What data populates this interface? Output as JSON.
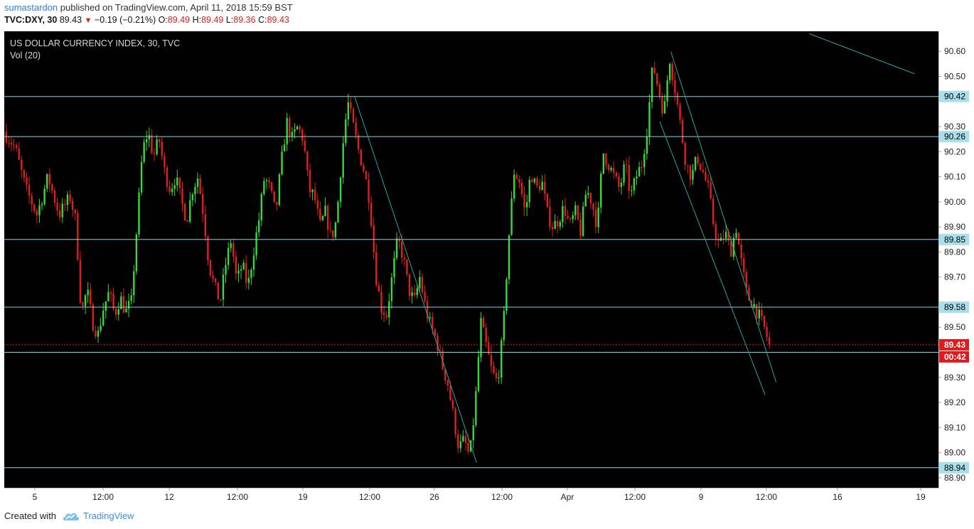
{
  "header": {
    "author": "sumastardon",
    "published_text": "published on TradingView.com, April 11, 2018 15:59 BST",
    "symbol": "TVC:DXY, 30",
    "last": "89.43",
    "change_arrow": "▼",
    "change": "−0.19 (−0.21%)",
    "o_label": "O:",
    "o_value": "89.49",
    "h_label": "H:",
    "h_value": "89.49",
    "l_label": "L:",
    "l_value": "89.36",
    "c_label": "C:",
    "c_value": "89.43"
  },
  "footer": {
    "created_with": "Created with",
    "brand": "TradingView"
  },
  "colors": {
    "background": "#000000",
    "up": "#37d93b",
    "down": "#e0201a",
    "level_line": "#7fd6e6",
    "trend_line": "#26a89a",
    "last_price": "#e01b1b",
    "axis_text": "#222222"
  },
  "chart_data": {
    "type": "candlestick",
    "title": "US DOLLAR CURRENCY INDEX, 30, TVC",
    "indicator": "Vol (20)",
    "ylim": [
      88.86,
      90.68
    ],
    "y_ticks": [
      "90.60",
      "90.50",
      "90.30",
      "90.20",
      "90.10",
      "90.00",
      "89.90",
      "89.80",
      "89.70",
      "89.50",
      "89.30",
      "89.20",
      "89.10",
      "89.00",
      "88.90"
    ],
    "x_ticks": [
      "5",
      "12:00",
      "12",
      "12:00",
      "19",
      "12:00",
      "26",
      "12:00",
      "Apr",
      "12:00",
      "9",
      "12:00",
      "16",
      "19"
    ],
    "horizontal_levels": [
      "90.42",
      "90.26",
      "89.85",
      "89.58",
      "89.40",
      "88.94"
    ],
    "last_price_label": "89.43",
    "countdown_label": "00:42",
    "price_path": [
      [
        0,
        90.28
      ],
      [
        2,
        90.22
      ],
      [
        4,
        90.05
      ],
      [
        6,
        89.95
      ],
      [
        8,
        90.1
      ],
      [
        10,
        89.95
      ],
      [
        12,
        90.02
      ],
      [
        13,
        89.92
      ],
      [
        14,
        89.55
      ],
      [
        15,
        89.65
      ],
      [
        16,
        89.52
      ],
      [
        17,
        89.47
      ],
      [
        18,
        89.58
      ],
      [
        19,
        89.64
      ],
      [
        20,
        89.55
      ],
      [
        21,
        89.62
      ],
      [
        22,
        89.56
      ],
      [
        23,
        89.6
      ],
      [
        24,
        89.9
      ],
      [
        25,
        90.2
      ],
      [
        26,
        90.28
      ],
      [
        27,
        90.18
      ],
      [
        28,
        90.25
      ],
      [
        29,
        90.12
      ],
      [
        30,
        90.05
      ],
      [
        31,
        90.1
      ],
      [
        32,
        90.0
      ],
      [
        33,
        89.93
      ],
      [
        34,
        90.05
      ],
      [
        35,
        90.1
      ],
      [
        36,
        89.95
      ],
      [
        37,
        89.75
      ],
      [
        38,
        89.66
      ],
      [
        39,
        89.6
      ],
      [
        40,
        89.75
      ],
      [
        41,
        89.85
      ],
      [
        42,
        89.68
      ],
      [
        43,
        89.75
      ],
      [
        44,
        89.66
      ],
      [
        45,
        89.8
      ],
      [
        46,
        89.93
      ],
      [
        47,
        90.1
      ],
      [
        48,
        90.05
      ],
      [
        49,
        89.95
      ],
      [
        50,
        90.15
      ],
      [
        51,
        90.32
      ],
      [
        52,
        90.25
      ],
      [
        53,
        90.3
      ],
      [
        54,
        90.25
      ],
      [
        55,
        90.05
      ],
      [
        56,
        90.02
      ],
      [
        57,
        89.9
      ],
      [
        58,
        89.96
      ],
      [
        59,
        89.85
      ],
      [
        60,
        89.93
      ],
      [
        61,
        90.2
      ],
      [
        62,
        90.4
      ],
      [
        63,
        90.3
      ],
      [
        64,
        90.2
      ],
      [
        65,
        90.12
      ],
      [
        66,
        90.0
      ],
      [
        67,
        89.72
      ],
      [
        68,
        89.58
      ],
      [
        69,
        89.55
      ],
      [
        70,
        89.7
      ],
      [
        71,
        89.85
      ],
      [
        72,
        89.78
      ],
      [
        73,
        89.65
      ],
      [
        74,
        89.6
      ],
      [
        75,
        89.7
      ],
      [
        76,
        89.58
      ],
      [
        77,
        89.5
      ],
      [
        78,
        89.45
      ],
      [
        79,
        89.35
      ],
      [
        80,
        89.28
      ],
      [
        81,
        89.15
      ],
      [
        82,
        89.02
      ],
      [
        83,
        89.05
      ],
      [
        84,
        88.98
      ],
      [
        85,
        89.2
      ],
      [
        86,
        89.52
      ],
      [
        87,
        89.42
      ],
      [
        88,
        89.32
      ],
      [
        89,
        89.28
      ],
      [
        90,
        89.48
      ],
      [
        91,
        89.85
      ],
      [
        92,
        90.12
      ],
      [
        93,
        90.08
      ],
      [
        94,
        89.95
      ],
      [
        95,
        90.12
      ],
      [
        96,
        90.05
      ],
      [
        97,
        90.08
      ],
      [
        98,
        89.95
      ],
      [
        99,
        89.9
      ],
      [
        100,
        89.93
      ],
      [
        101,
        89.98
      ],
      [
        102,
        89.9
      ],
      [
        103,
        89.96
      ],
      [
        104,
        89.88
      ],
      [
        105,
        90.05
      ],
      [
        106,
        90.0
      ],
      [
        107,
        89.9
      ],
      [
        108,
        90.2
      ],
      [
        109,
        90.15
      ],
      [
        110,
        90.1
      ],
      [
        111,
        90.05
      ],
      [
        112,
        90.15
      ],
      [
        113,
        90.02
      ],
      [
        114,
        90.1
      ],
      [
        115,
        90.15
      ],
      [
        116,
        90.3
      ],
      [
        117,
        90.55
      ],
      [
        118,
        90.45
      ],
      [
        119,
        90.35
      ],
      [
        120,
        90.58
      ],
      [
        121,
        90.45
      ],
      [
        122,
        90.3
      ],
      [
        123,
        90.15
      ],
      [
        124,
        90.1
      ],
      [
        125,
        90.18
      ],
      [
        126,
        90.12
      ],
      [
        127,
        90.05
      ],
      [
        128,
        89.9
      ],
      [
        129,
        89.82
      ],
      [
        130,
        89.88
      ],
      [
        131,
        89.8
      ],
      [
        132,
        89.9
      ],
      [
        133,
        89.75
      ],
      [
        134,
        89.62
      ],
      [
        135,
        89.6
      ],
      [
        136,
        89.55
      ],
      [
        137,
        89.5
      ],
      [
        138,
        89.43
      ]
    ]
  }
}
